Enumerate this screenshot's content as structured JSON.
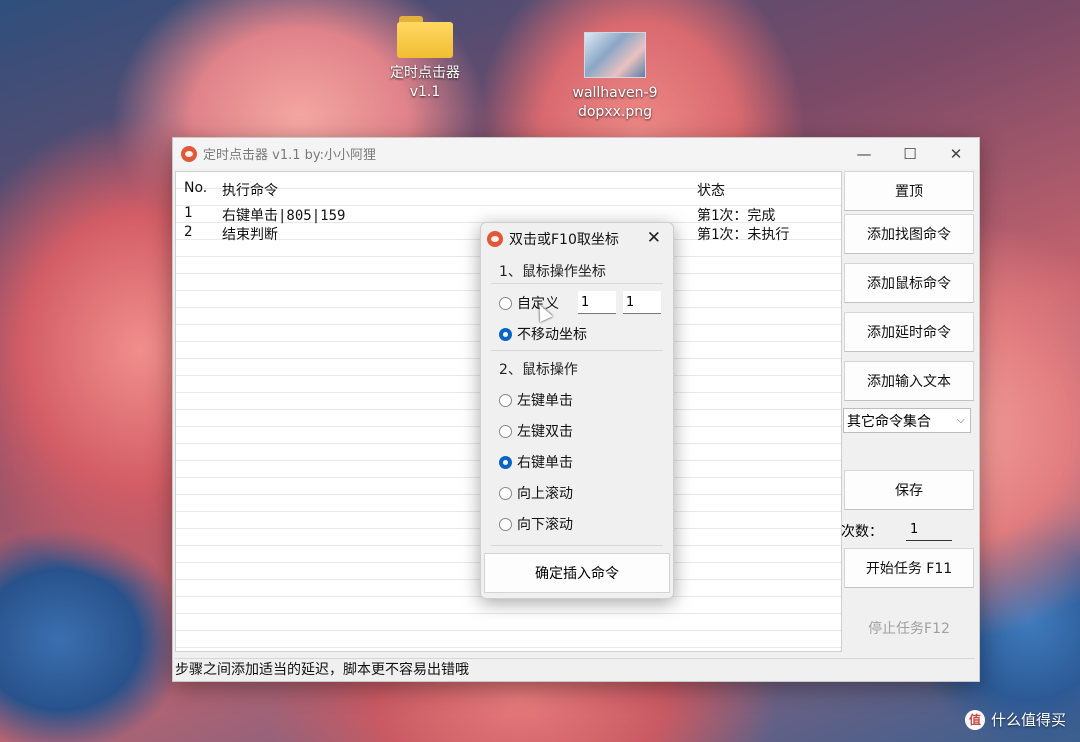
{
  "desktop": {
    "icons": [
      {
        "line1": "定时点击器",
        "line2": "v1.1"
      },
      {
        "line1": "wallhaven-9",
        "line2": "dopxx.png"
      }
    ]
  },
  "window": {
    "title": "定时点击器 v1.1 by:小小阿狸",
    "controls": {
      "minimize": "—",
      "maximize": "☐",
      "close": "✕"
    }
  },
  "table": {
    "columns": [
      "No.",
      "执行命令",
      "状态"
    ],
    "rows": [
      {
        "no": "1",
        "command": "右键单击|805|159",
        "status": "第1次：完成"
      },
      {
        "no": "2",
        "command": "结束判断",
        "status": "第1次：未执行"
      }
    ]
  },
  "sidebar": {
    "pin": "置顶",
    "add_find_image": "添加找图命令",
    "add_mouse": "添加鼠标命令",
    "add_delay": "添加延时命令",
    "add_text": "添加输入文本",
    "other_select": "其它命令集合",
    "save": "保存",
    "count_label": "次数：",
    "count_value": "1",
    "start": "开始任务 F11",
    "stop": "停止任务F12"
  },
  "status_bar": "步骤之间添加适当的延迟，脚本更不容易出错哦",
  "dialog": {
    "title": "双击或F10取坐标",
    "close": "✕",
    "section1": "1、鼠标操作坐标",
    "opt_custom": "自定义",
    "coord_x": "1",
    "coord_y": "1",
    "opt_nomove": "不移动坐标",
    "section2": "2、鼠标操作",
    "ops": [
      "左键单击",
      "左键双击",
      "右键单击",
      "向上滚动",
      "向下滚动"
    ],
    "selected_op": "右键单击",
    "selected_coord_mode": "不移动坐标",
    "confirm": "确定插入命令"
  },
  "watermark": {
    "icon": "值",
    "text": "什么值得买"
  }
}
